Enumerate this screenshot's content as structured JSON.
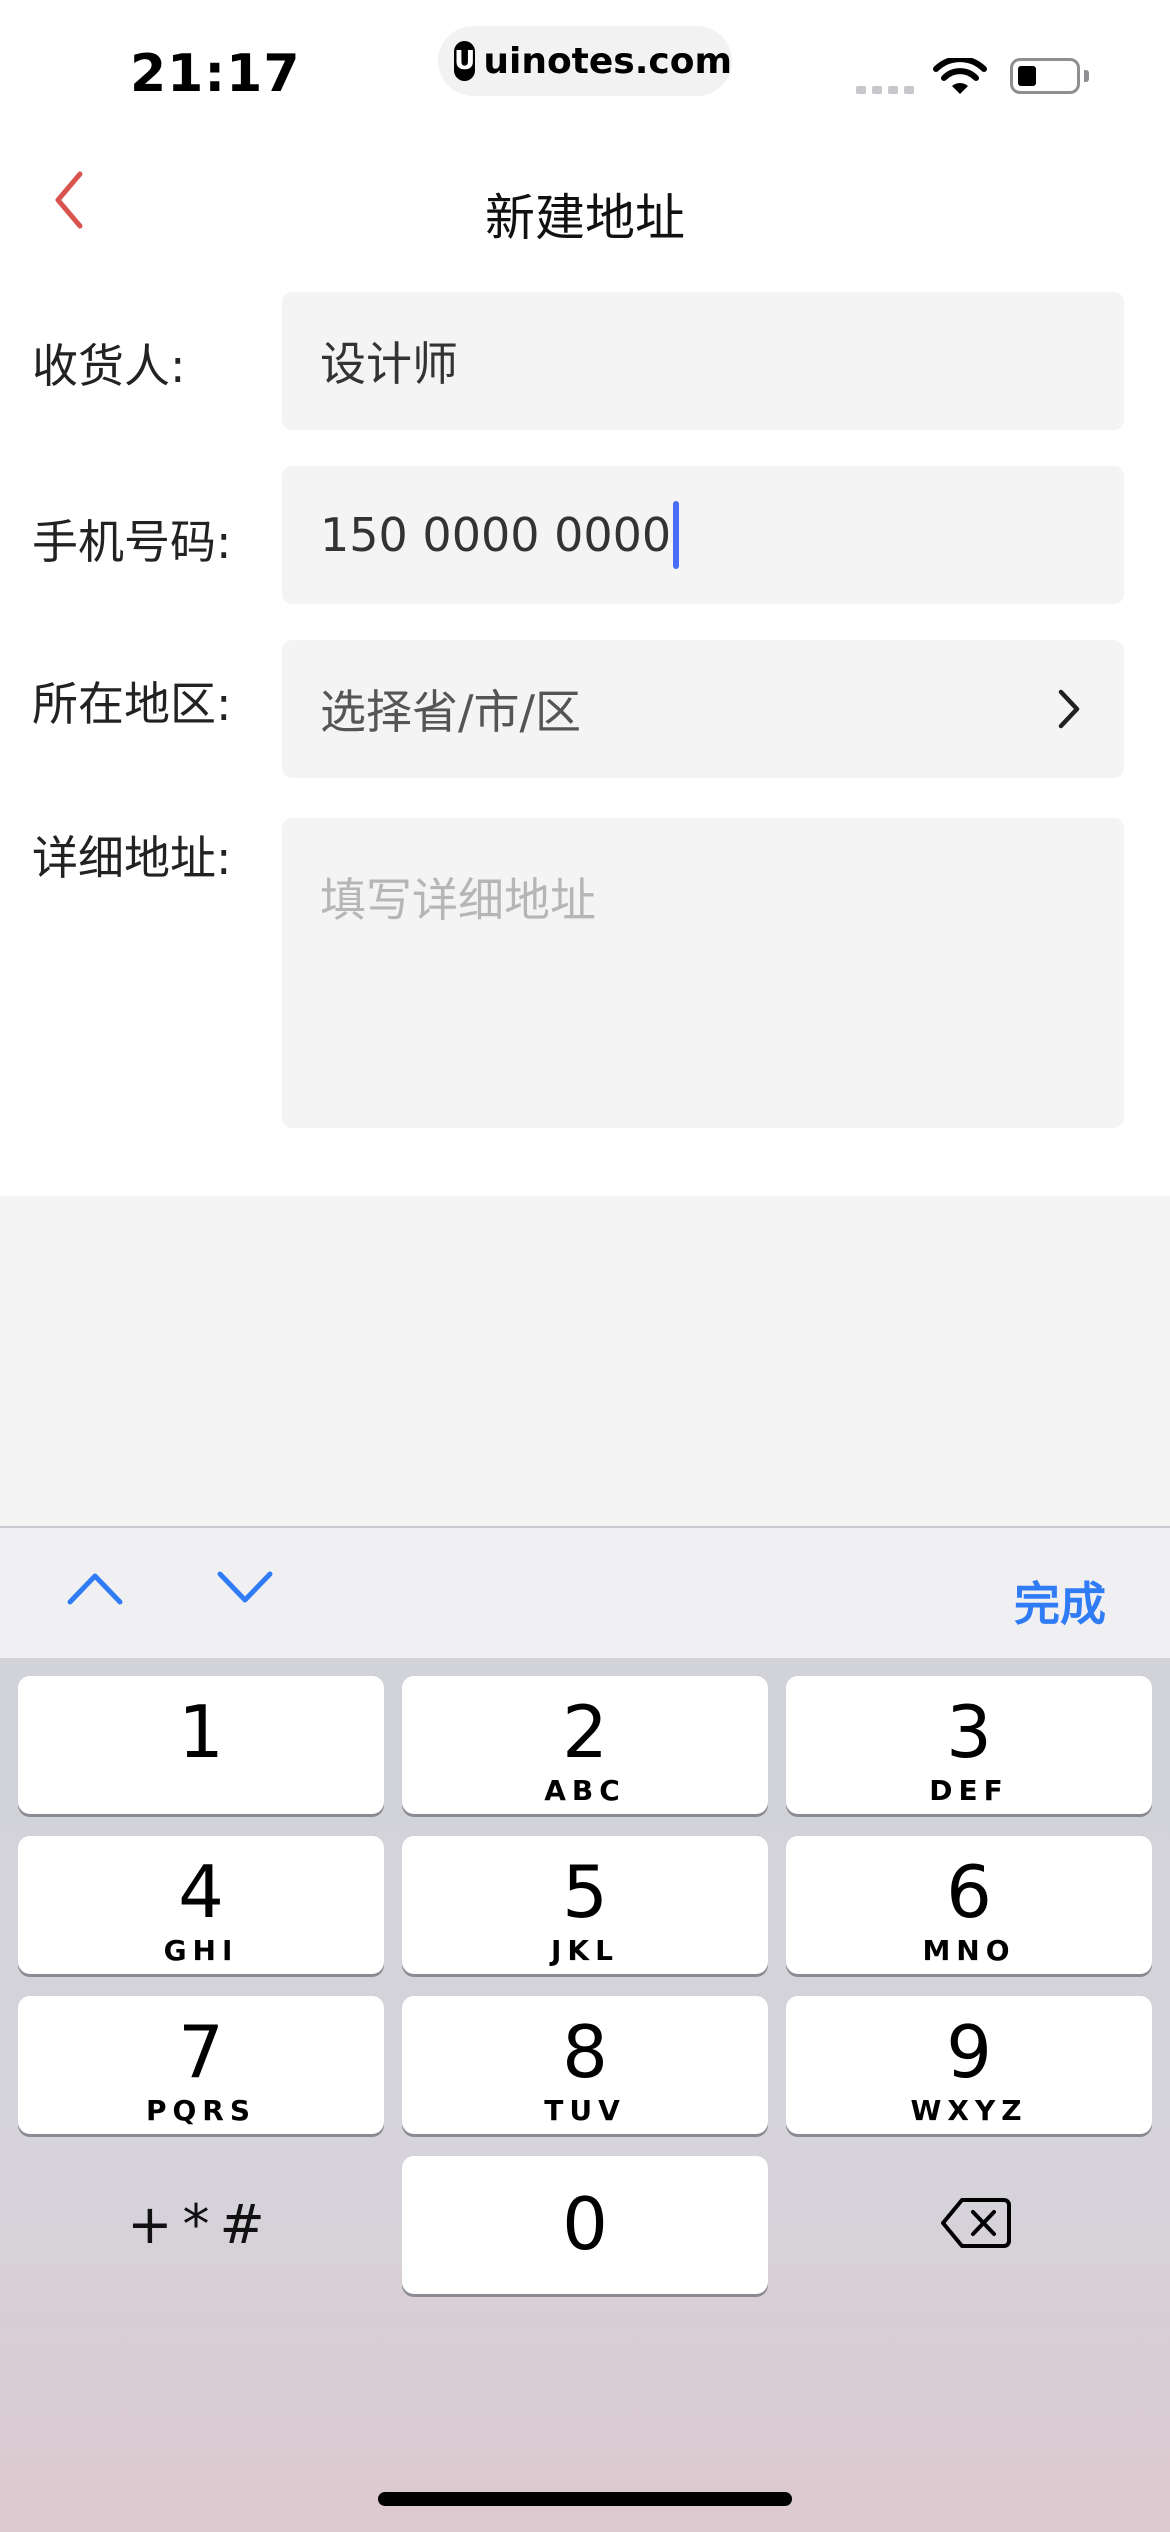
{
  "status_bar": {
    "time": "21:17",
    "site": "uinotes.com",
    "site_logo_letter": "U"
  },
  "nav": {
    "title": "新建地址",
    "back_icon": "chevron-left-icon",
    "accent_color": "#d9534f"
  },
  "form": {
    "recipient": {
      "label": "收货人:",
      "value": "设计师"
    },
    "phone": {
      "label": "手机号码:",
      "value": "150 0000 0000"
    },
    "region": {
      "label": "所在地区:",
      "value": "选择省/市/区"
    },
    "address": {
      "label": "详细地址:",
      "placeholder": "填写详细地址"
    }
  },
  "accessory_bar": {
    "done_label": "完成",
    "prev_icon": "chevron-up-icon",
    "next_icon": "chevron-down-icon",
    "accent_color": "#2f7cf6"
  },
  "keypad": {
    "keys": [
      {
        "num": "1",
        "letters": ""
      },
      {
        "num": "2",
        "letters": "ABC"
      },
      {
        "num": "3",
        "letters": "DEF"
      },
      {
        "num": "4",
        "letters": "GHI"
      },
      {
        "num": "5",
        "letters": "JKL"
      },
      {
        "num": "6",
        "letters": "MNO"
      },
      {
        "num": "7",
        "letters": "PQRS"
      },
      {
        "num": "8",
        "letters": "TUV"
      },
      {
        "num": "9",
        "letters": "WXYZ"
      },
      {
        "num": "0",
        "letters": ""
      }
    ],
    "symbols_label": "+*#",
    "delete_icon": "backspace-icon"
  }
}
